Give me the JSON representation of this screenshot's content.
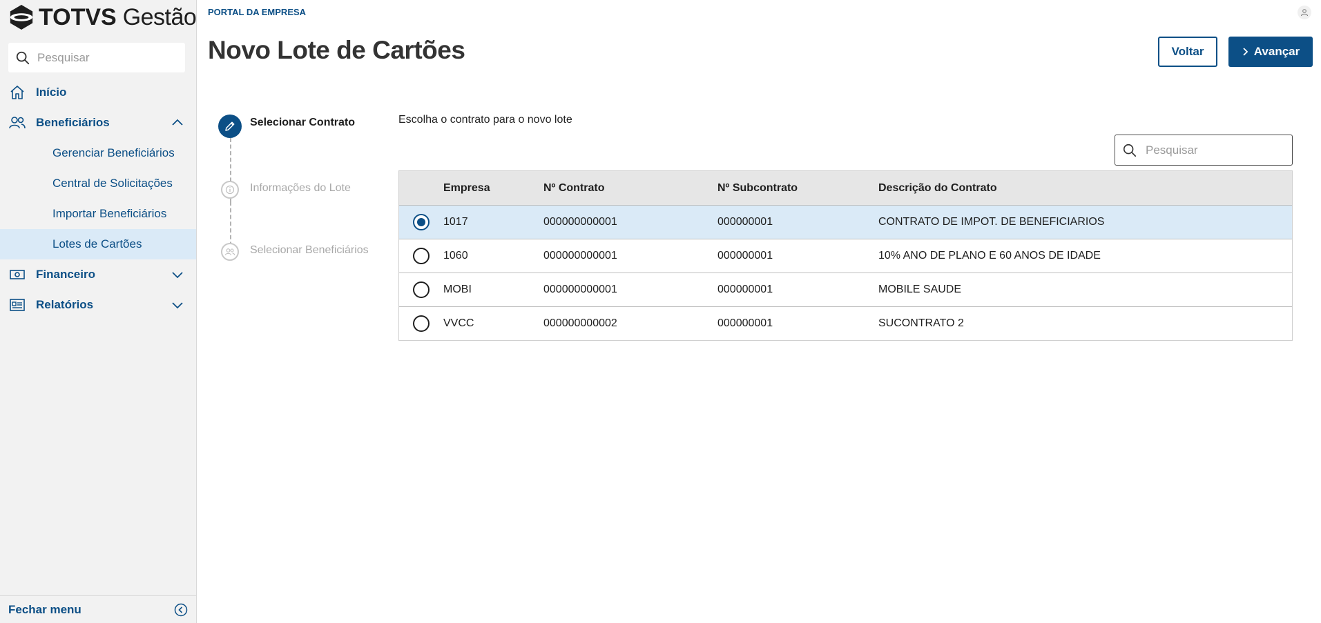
{
  "sidebar": {
    "logo": {
      "brand": "TOTVS",
      "product": "Gestão"
    },
    "search": {
      "placeholder": "Pesquisar"
    },
    "nav": {
      "inicio": "Início",
      "beneficiarios": "Beneficiários",
      "beneficiarios_sub": [
        "Gerenciar Beneficiários",
        "Central de Solicitações",
        "Importar Beneficiários",
        "Lotes de Cartões"
      ],
      "financeiro": "Financeiro",
      "relatorios": "Relatórios"
    },
    "footer": {
      "label": "Fechar menu"
    }
  },
  "header": {
    "breadcrumb": "PORTAL DA EMPRESA",
    "title": "Novo Lote de Cartões",
    "back_label": "Voltar",
    "next_label": "Avançar"
  },
  "stepper": {
    "steps": [
      {
        "label": "Selecionar Contrato",
        "state": "active",
        "icon": "pencil-icon"
      },
      {
        "label": "Informações do Lote",
        "state": "inactive",
        "icon": "info-icon"
      },
      {
        "label": "Selecionar Beneficiários",
        "state": "inactive",
        "icon": "users-icon"
      }
    ]
  },
  "content": {
    "instruction": "Escolha o contrato para o novo lote",
    "search": {
      "placeholder": "Pesquisar"
    },
    "table": {
      "columns": [
        "Empresa",
        "Nº Contrato",
        "Nº Subcontrato",
        "Descrição do Contrato"
      ],
      "rows": [
        {
          "empresa": "1017",
          "contrato": "000000000001",
          "subcontrato": "000000001",
          "descricao": "CONTRATO DE IMPOT. DE BENEFICIARIOS",
          "selected": true
        },
        {
          "empresa": "1060",
          "contrato": "000000000001",
          "subcontrato": "000000001",
          "descricao": "10% ANO DE PLANO E 60 ANOS DE IDADE",
          "selected": false
        },
        {
          "empresa": "MOBI",
          "contrato": "000000000001",
          "subcontrato": "000000001",
          "descricao": "MOBILE SAUDE",
          "selected": false
        },
        {
          "empresa": "VVCC",
          "contrato": "000000000002",
          "subcontrato": "000000001",
          "descricao": "SUCONTRATO 2",
          "selected": false
        }
      ]
    }
  },
  "colors": {
    "primary": "#0c4f86",
    "selected_row": "#daeaf7",
    "sidebar_bg": "#f2f2f2"
  }
}
